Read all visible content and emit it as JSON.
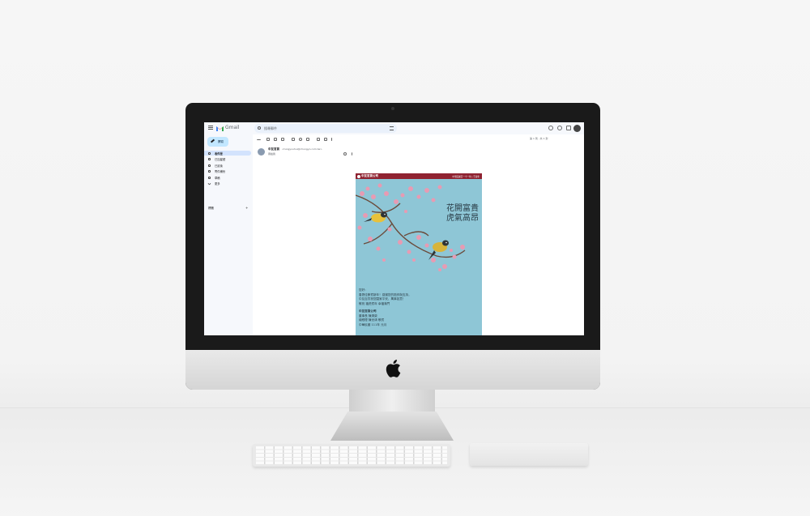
{
  "gmail": {
    "app_name": "Gmail",
    "search_placeholder": "搜尋郵件",
    "compose_label": "撰寫",
    "nav": [
      "收件匣",
      "已加星號",
      "已延後",
      "寄件備份",
      "草稿",
      "更多"
    ],
    "labels_heading": "標籤",
    "labels_add": "+",
    "pager": "第 1 到 , 共 1 封",
    "message": {
      "sender_name": "中友百貨",
      "sender_email": "<tungyouhui@chungyo.com.tw>",
      "recipient": "寄給我"
    }
  },
  "email_card": {
    "company": "中友百貨公司",
    "header_right": "中華民國百一十一年 | 壬寅年",
    "title_line1": "花開富貴",
    "title_line2": "虎氣高昂",
    "body_lines": [
      "您好：",
      "春昂佳節賀新年！感謝您的陪伴與支持，",
      "中友百貨祝您闔家平安、萬事如意！",
      "敬祝 福虎賀年 幸福滿門"
    ],
    "sign_company": "中友百貨公司",
    "sign_lines": [
      "董事長 陳清榮",
      "總經理 陳世鴻 敬賀",
      "中華民國 111年 元月"
    ]
  },
  "colors": {
    "card_background": "#8ec6d6",
    "card_header": "#8f2331",
    "compose_button": "#c2e7ff",
    "nav_active": "#d3e3fd"
  }
}
